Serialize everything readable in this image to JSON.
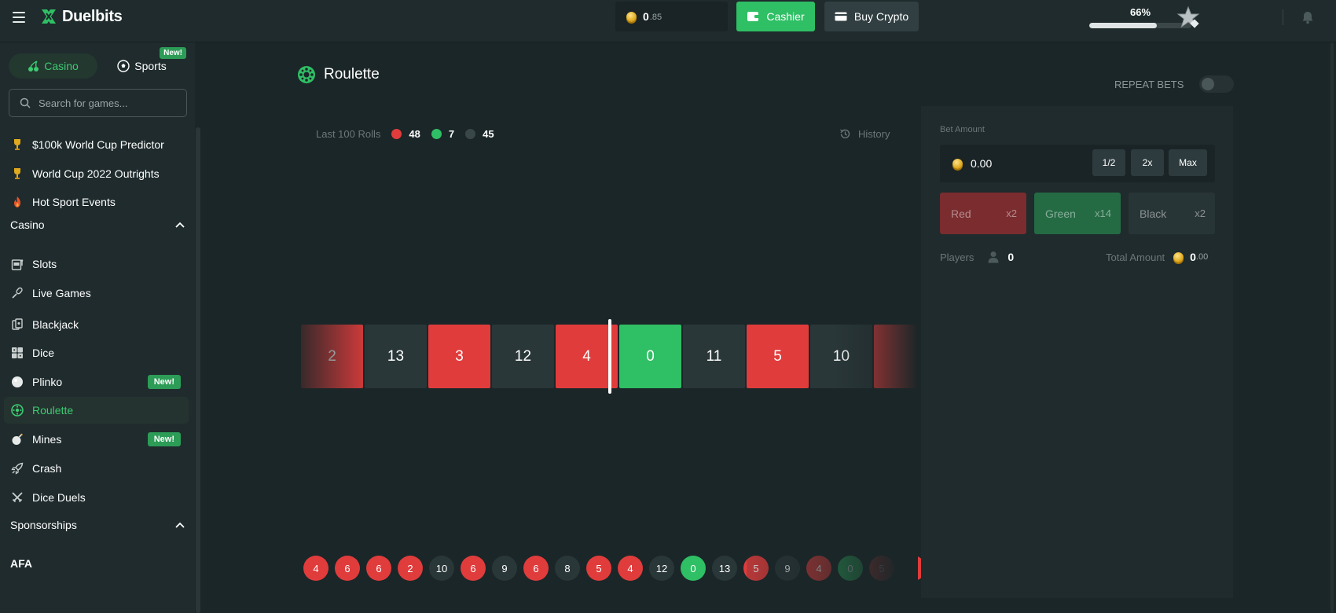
{
  "header": {
    "logo_text": "Duelbits",
    "balance_main": "0",
    "balance_decimal": ".85",
    "cashier_label": "Cashier",
    "buy_crypto_label": "Buy Crypto",
    "xp_percent_text": "66%",
    "xp_progress_fraction": 0.66
  },
  "sidebar": {
    "tab_casino": "Casino",
    "tab_sports": "Sports",
    "sports_badge": "New!",
    "search_placeholder": "Search for games...",
    "featured": [
      {
        "label": "$100k World Cup Predictor",
        "icon": "trophy-icon"
      },
      {
        "label": "World Cup 2022 Outrights",
        "icon": "trophy-icon"
      },
      {
        "label": "Hot Sport Events",
        "icon": "fire-icon"
      }
    ],
    "casino_section": "Casino",
    "casino_items": [
      {
        "label": "Slots",
        "icon": "slot-machine-icon",
        "badge": ""
      },
      {
        "label": "Live Games",
        "icon": "microphone-icon",
        "badge": ""
      },
      {
        "label": "Blackjack",
        "icon": "cards-icon",
        "badge": ""
      },
      {
        "label": "Dice",
        "icon": "dice-icon",
        "badge": ""
      },
      {
        "label": "Plinko",
        "icon": "plinko-ball-icon",
        "badge": "New!"
      },
      {
        "label": "Roulette",
        "icon": "roulette-icon",
        "badge": ""
      },
      {
        "label": "Mines",
        "icon": "bomb-icon",
        "badge": "New!"
      },
      {
        "label": "Crash",
        "icon": "rocket-icon",
        "badge": ""
      },
      {
        "label": "Dice Duels",
        "icon": "crossed-swords-icon",
        "badge": ""
      }
    ],
    "sponsorships_section": "Sponsorships",
    "sponsorship_items": [
      {
        "label": "AFA"
      }
    ]
  },
  "game": {
    "title": "Roulette",
    "repeat_bets_label": "REPEAT BETS",
    "last_rolls_label": "Last 100 Rolls",
    "red_count": "48",
    "green_count": "7",
    "black_count": "45",
    "history_label": "History",
    "strip": [
      {
        "n": "2",
        "c": "red"
      },
      {
        "n": "13",
        "c": "black"
      },
      {
        "n": "3",
        "c": "red"
      },
      {
        "n": "12",
        "c": "black"
      },
      {
        "n": "4",
        "c": "red"
      },
      {
        "n": "0",
        "c": "green"
      },
      {
        "n": "11",
        "c": "black"
      },
      {
        "n": "5",
        "c": "red"
      },
      {
        "n": "10",
        "c": "black"
      },
      {
        "n": "",
        "c": "red"
      }
    ],
    "recent": [
      {
        "n": "4",
        "c": "red"
      },
      {
        "n": "6",
        "c": "red"
      },
      {
        "n": "6",
        "c": "red"
      },
      {
        "n": "2",
        "c": "red"
      },
      {
        "n": "10",
        "c": "black"
      },
      {
        "n": "6",
        "c": "red"
      },
      {
        "n": "9",
        "c": "black"
      },
      {
        "n": "6",
        "c": "red"
      },
      {
        "n": "8",
        "c": "black"
      },
      {
        "n": "5",
        "c": "red"
      },
      {
        "n": "4",
        "c": "red"
      },
      {
        "n": "12",
        "c": "black"
      },
      {
        "n": "0",
        "c": "green"
      },
      {
        "n": "13",
        "c": "black"
      },
      {
        "n": "5",
        "c": "red"
      },
      {
        "n": "9",
        "c": "black"
      },
      {
        "n": "4",
        "c": "red"
      },
      {
        "n": "0",
        "c": "green"
      },
      {
        "n": "5",
        "c": "red"
      },
      {
        "n": "",
        "c": "red"
      }
    ]
  },
  "bet": {
    "amount_label": "Bet Amount",
    "amount_value": "0.00",
    "half_label": "1/2",
    "double_label": "2x",
    "max_label": "Max",
    "red_label": "Red",
    "red_mult": "x2",
    "green_label": "Green",
    "green_mult": "x14",
    "black_label": "Black",
    "black_mult": "x2",
    "players_label": "Players",
    "players_value": "0",
    "total_label": "Total Amount",
    "total_main": "0",
    "total_decimal": ".00"
  },
  "colors": {
    "accent_green": "#2fbf65",
    "red": "#e03c3c",
    "black": "#2a3739",
    "background": "#1b2628",
    "panel": "#1f2b2d"
  }
}
